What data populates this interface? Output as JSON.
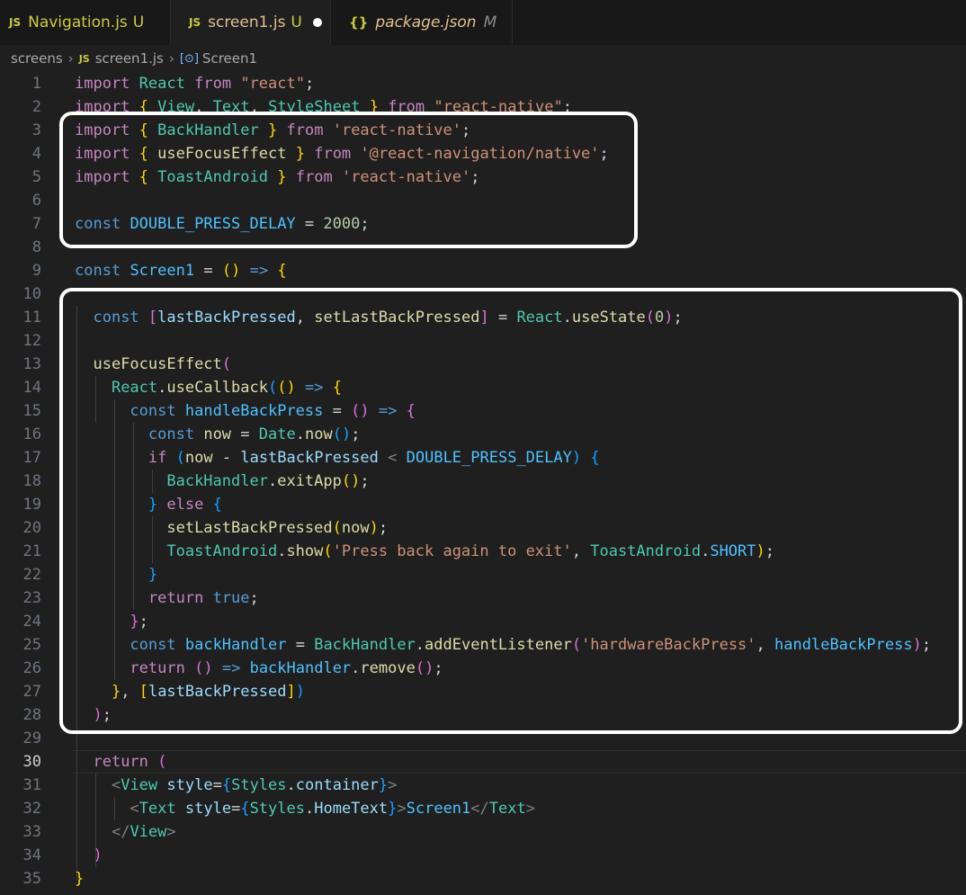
{
  "tabs": [
    {
      "badge": "JS",
      "name": "Navigation.js",
      "status": "U"
    },
    {
      "badge": "JS",
      "name": "screen1.js",
      "status": "U"
    },
    {
      "badge": "{}",
      "name": "package.json",
      "status": "M"
    }
  ],
  "breadcrumb": {
    "folder": "screens",
    "file_badge": "JS",
    "file": "screen1.js",
    "symbol_icon": "symbol-method-icon",
    "symbol": "Screen1"
  },
  "current_line": 30,
  "code_lines": [
    "import React from \"react\";",
    "import { View, Text, StyleSheet } from \"react-native\";",
    "import { BackHandler } from 'react-native';",
    "import { useFocusEffect } from '@react-navigation/native';",
    "import { ToastAndroid } from 'react-native';",
    "",
    "const DOUBLE_PRESS_DELAY = 2000;",
    "",
    "const Screen1 = () => {",
    "",
    "  const [lastBackPressed, setLastBackPressed] = React.useState(0);",
    "",
    "  useFocusEffect(",
    "    React.useCallback(() => {",
    "      const handleBackPress = () => {",
    "        const now = Date.now();",
    "        if (now - lastBackPressed < DOUBLE_PRESS_DELAY) {",
    "          BackHandler.exitApp();",
    "        } else {",
    "          setLastBackPressed(now);",
    "          ToastAndroid.show('Press back again to exit', ToastAndroid.SHORT);",
    "        }",
    "        return true;",
    "      };",
    "      const backHandler = BackHandler.addEventListener('hardwareBackPress', handleBackPress);",
    "      return () => backHandler.remove();",
    "    }, [lastBackPressed])",
    "  );",
    "",
    "  return (",
    "    <View style={Styles.container}>",
    "      <Text style={Styles.HomeText}>Screen1</Text>",
    "    </View>",
    "  )",
    "}"
  ],
  "colors": {
    "editor_bg": "#1f1f1f",
    "highlight_border": "#ffffff",
    "keyword": "#c586c0",
    "string": "#ce9178",
    "function": "#dcdcaa"
  }
}
